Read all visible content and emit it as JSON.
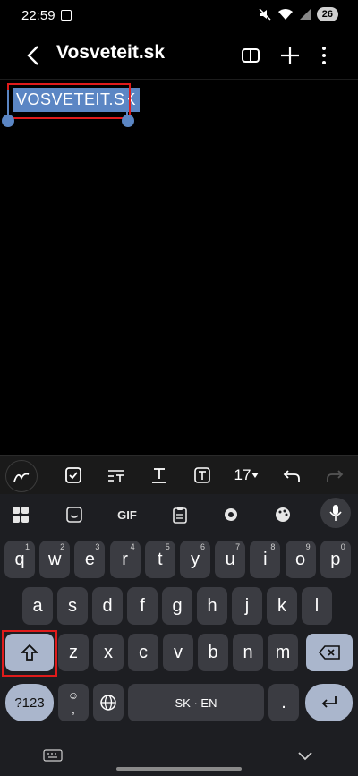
{
  "status": {
    "time": "22:59",
    "battery": "26"
  },
  "header": {
    "title": "Vosveteit.sk"
  },
  "note": {
    "selected_text": "VOSVETEIT.SK"
  },
  "toolbar": {
    "font_size": "17"
  },
  "keyboard": {
    "tools": [
      "apps",
      "sticker",
      "GIF",
      "clipboard",
      "settings",
      "theme",
      "voice"
    ],
    "gif_label": "GIF",
    "row1": [
      {
        "k": "q",
        "s": "1"
      },
      {
        "k": "w",
        "s": "2"
      },
      {
        "k": "e",
        "s": "3"
      },
      {
        "k": "r",
        "s": "4"
      },
      {
        "k": "t",
        "s": "5"
      },
      {
        "k": "y",
        "s": "6"
      },
      {
        "k": "u",
        "s": "7"
      },
      {
        "k": "i",
        "s": "8"
      },
      {
        "k": "o",
        "s": "9"
      },
      {
        "k": "p",
        "s": "0"
      }
    ],
    "row2": [
      "a",
      "s",
      "d",
      "f",
      "g",
      "h",
      "j",
      "k",
      "l"
    ],
    "row3": [
      "z",
      "x",
      "c",
      "v",
      "b",
      "n",
      "m"
    ],
    "symbols_label": "?123",
    "emoji_comma": ",",
    "space_label": "SK · EN",
    "period_label": "."
  }
}
